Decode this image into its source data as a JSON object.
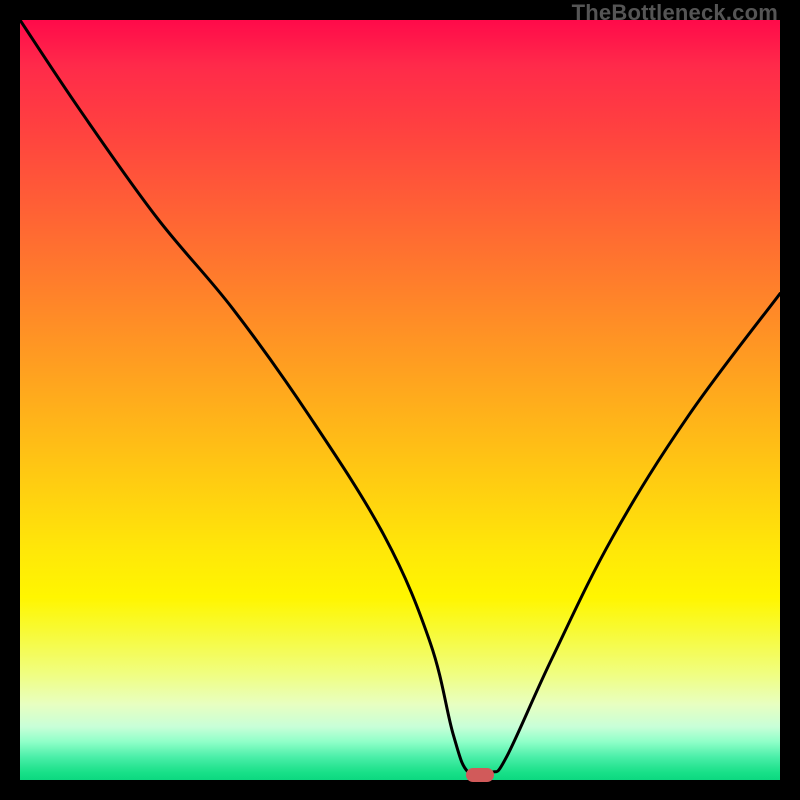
{
  "attribution": "TheBottleneck.com",
  "chart_data": {
    "type": "line",
    "title": "",
    "xlabel": "",
    "ylabel": "",
    "xlim": [
      0,
      100
    ],
    "ylim": [
      0,
      100
    ],
    "series": [
      {
        "name": "bottleneck-curve",
        "x": [
          0,
          8,
          18,
          28,
          38,
          48,
          54,
          57,
          59,
          62,
          64,
          70,
          78,
          88,
          100
        ],
        "values": [
          100,
          88,
          74,
          62,
          48,
          32,
          18,
          6,
          1,
          1,
          3,
          16,
          32,
          48,
          64
        ]
      }
    ],
    "marker": {
      "x": 60.5,
      "y": 0.6
    },
    "gradient_stops": [
      {
        "pos": 0,
        "color": "#ff0a4a"
      },
      {
        "pos": 50,
        "color": "#ffb818"
      },
      {
        "pos": 80,
        "color": "#fff600"
      },
      {
        "pos": 100,
        "color": "#0cd880"
      }
    ]
  }
}
